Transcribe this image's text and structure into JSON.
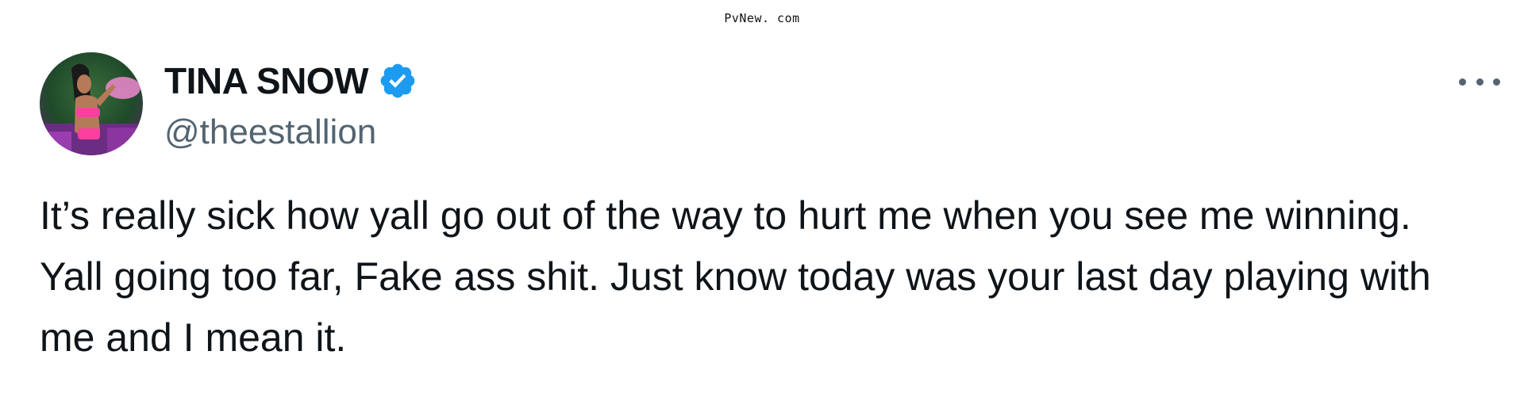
{
  "watermark": "PvNew. com",
  "tweet": {
    "display_name": "TINA SNOW",
    "handle": "@theestallion",
    "verified": true,
    "text": "It’s really sick how yall go out of the way to hurt me when you see me winning. Yall going too far, Fake ass shit. Just know today was your last day playing with me and I mean it."
  },
  "icons": {
    "verified": "verified-badge-icon",
    "more": "more-options-icon"
  },
  "colors": {
    "verified_blue": "#1d9bf0",
    "handle_gray": "#536471",
    "text": "#0f1419"
  }
}
